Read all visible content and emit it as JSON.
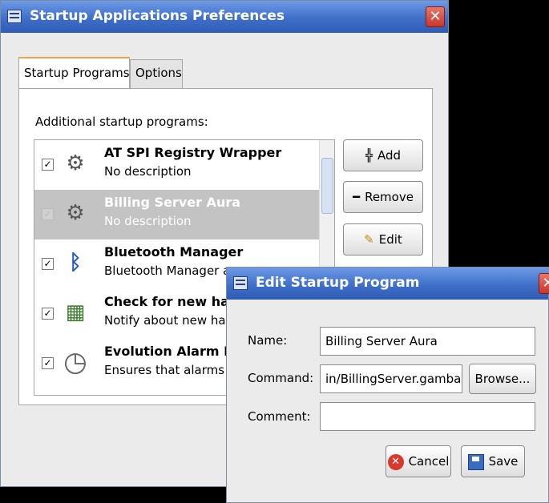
{
  "main_window": {
    "title": "Startup Applications Preferences",
    "tabs": [
      {
        "label": "Startup Programs",
        "active": true
      },
      {
        "label": "Options",
        "active": false
      }
    ],
    "list_label": "Additional startup programs:",
    "programs": [
      {
        "name": "AT SPI Registry Wrapper",
        "description": "No description",
        "checked": true,
        "selected": false,
        "icon": "gears-icon"
      },
      {
        "name": "Billing Server Aura",
        "description": "No description",
        "checked": true,
        "selected": true,
        "icon": "gears-icon"
      },
      {
        "name": "Bluetooth Manager",
        "description": "Bluetooth Manager ap",
        "checked": true,
        "selected": false,
        "icon": "bluetooth-icon"
      },
      {
        "name": "Check for new har",
        "description": "Notify about new har",
        "checked": true,
        "selected": false,
        "icon": "hardware-icon"
      },
      {
        "name": "Evolution Alarm No",
        "description": "Ensures that alarms s",
        "checked": true,
        "selected": false,
        "icon": "clock-icon"
      }
    ],
    "buttons": {
      "add": "Add",
      "remove": "Remove",
      "edit": "Edit"
    }
  },
  "dialog": {
    "title": "Edit Startup Program",
    "name_label": "Name:",
    "name_value": "Billing Server Aura",
    "command_label": "Command:",
    "command_value": "in/BillingServer.gambas",
    "comment_label": "Comment:",
    "comment_value": "",
    "browse": "Browse...",
    "cancel": "Cancel",
    "save": "Save"
  },
  "colors": {
    "titlebar": "#3f6fc9",
    "close_button": "#c7372b",
    "selection": "#c3c3c3",
    "active_tab_accent": "#f0a04b"
  }
}
